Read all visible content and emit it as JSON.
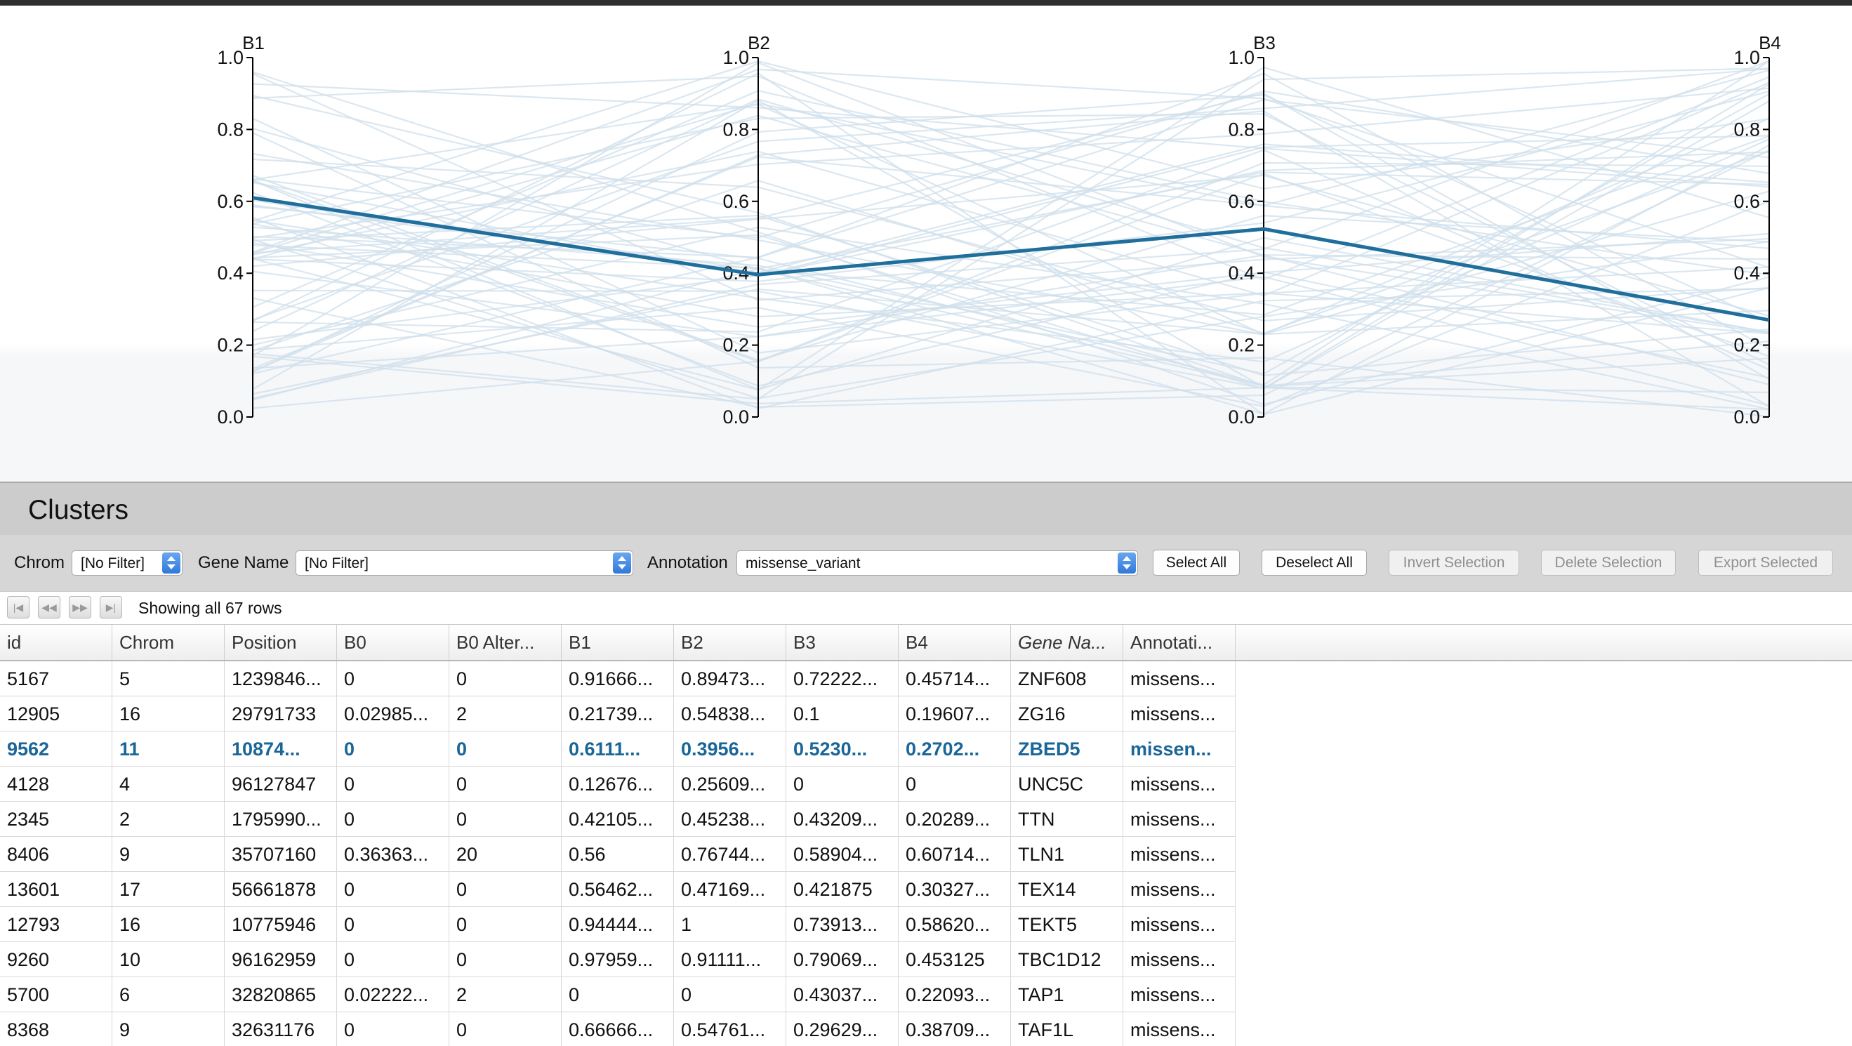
{
  "parallel_coordinates": {
    "axes": [
      "B1",
      "B2",
      "B3",
      "B4"
    ],
    "ticks": [
      "0.0",
      "0.2",
      "0.4",
      "0.6",
      "0.8",
      "1.0"
    ],
    "colors": {
      "background_lines": "#cfdfeb",
      "highlight_line": "#1f6e9c"
    },
    "highlighted_record": [
      0.61,
      0.396,
      0.523,
      0.27
    ]
  },
  "clusters": {
    "title": "Clusters",
    "filters": {
      "chrom_label": "Chrom",
      "chrom_value": "[No Filter]",
      "gene_label": "Gene Name",
      "gene_value": "[No Filter]",
      "annotation_label": "Annotation",
      "annotation_value": "missense_variant"
    },
    "buttons": {
      "select_all": "Select All",
      "deselect_all": "Deselect All",
      "invert_selection": "Invert Selection",
      "delete_selection": "Delete Selection",
      "export_selected": "Export Selected"
    },
    "pager": {
      "status": "Showing all 67 rows"
    },
    "columns": [
      "id",
      "Chrom",
      "Position",
      "B0",
      "B0 Alter...",
      "B1",
      "B2",
      "B3",
      "B4",
      "Gene Na...",
      "Annotati..."
    ],
    "rows": [
      {
        "selected": false,
        "cells": [
          "5167",
          "5",
          "1239846...",
          "0",
          "0",
          "0.91666...",
          "0.89473...",
          "0.72222...",
          "0.45714...",
          "ZNF608",
          "missens..."
        ]
      },
      {
        "selected": false,
        "cells": [
          "12905",
          "16",
          "29791733",
          "0.02985...",
          "2",
          "0.21739...",
          "0.54838...",
          "0.1",
          "0.19607...",
          "ZG16",
          "missens..."
        ]
      },
      {
        "selected": true,
        "cells": [
          "9562",
          "11",
          "10874...",
          "0",
          "0",
          "0.6111...",
          "0.3956...",
          "0.5230...",
          "0.2702...",
          "ZBED5",
          "missen..."
        ]
      },
      {
        "selected": false,
        "cells": [
          "4128",
          "4",
          "96127847",
          "0",
          "0",
          "0.12676...",
          "0.25609...",
          "0",
          "0",
          "UNC5C",
          "missens..."
        ]
      },
      {
        "selected": false,
        "cells": [
          "2345",
          "2",
          "1795990...",
          "0",
          "0",
          "0.42105...",
          "0.45238...",
          "0.43209...",
          "0.20289...",
          "TTN",
          "missens..."
        ]
      },
      {
        "selected": false,
        "cells": [
          "8406",
          "9",
          "35707160",
          "0.36363...",
          "20",
          "0.56",
          "0.76744...",
          "0.58904...",
          "0.60714...",
          "TLN1",
          "missens..."
        ]
      },
      {
        "selected": false,
        "cells": [
          "13601",
          "17",
          "56661878",
          "0",
          "0",
          "0.56462...",
          "0.47169...",
          "0.421875",
          "0.30327...",
          "TEX14",
          "missens..."
        ]
      },
      {
        "selected": false,
        "cells": [
          "12793",
          "16",
          "10775946",
          "0",
          "0",
          "0.94444...",
          "1",
          "0.73913...",
          "0.58620...",
          "TEKT5",
          "missens..."
        ]
      },
      {
        "selected": false,
        "cells": [
          "9260",
          "10",
          "96162959",
          "0",
          "0",
          "0.97959...",
          "0.91111...",
          "0.79069...",
          "0.453125",
          "TBC1D12",
          "missens..."
        ]
      },
      {
        "selected": false,
        "cells": [
          "5700",
          "6",
          "32820865",
          "0.02222...",
          "2",
          "0",
          "0",
          "0.43037...",
          "0.22093...",
          "TAP1",
          "missens..."
        ]
      },
      {
        "selected": false,
        "cells": [
          "8368",
          "9",
          "32631176",
          "0",
          "0",
          "0.66666...",
          "0.54761...",
          "0.29629...",
          "0.38709...",
          "TAF1L",
          "missens..."
        ]
      }
    ]
  }
}
